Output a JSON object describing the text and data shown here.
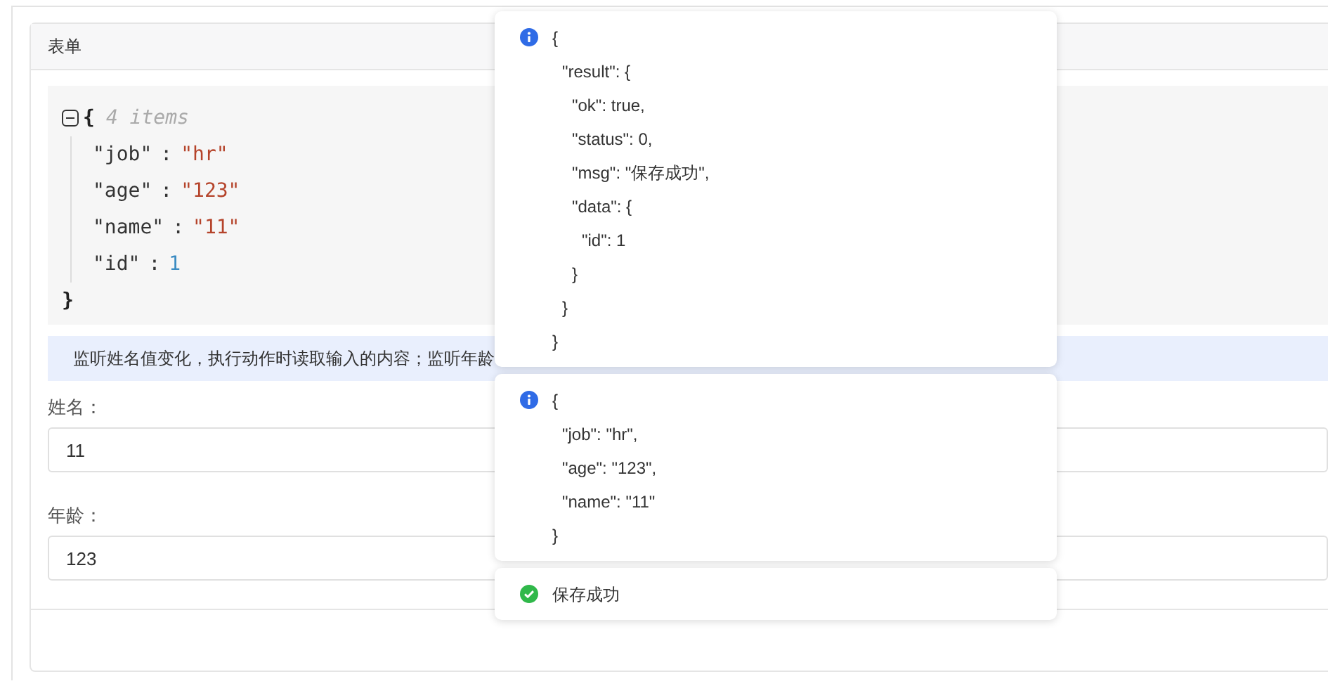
{
  "panel": {
    "title": "表单"
  },
  "json_view": {
    "expanded": true,
    "open_brace": "{",
    "summary": "4 items",
    "close_brace": "}",
    "entries": [
      {
        "key": "\"job\"",
        "separator": ":",
        "value": "\"hr\"",
        "kind": "string"
      },
      {
        "key": "\"age\"",
        "separator": ":",
        "value": "\"123\"",
        "kind": "string"
      },
      {
        "key": "\"name\"",
        "separator": ":",
        "value": "\"11\"",
        "kind": "string"
      },
      {
        "key": "\"id\"",
        "separator": ":",
        "value": "1",
        "kind": "number"
      }
    ]
  },
  "alert": {
    "text": "监听姓名值变化，执行动作时读取输入的内容；监听年龄"
  },
  "fields": [
    {
      "label": "姓名：",
      "value": "11"
    },
    {
      "label": "年龄：",
      "value": "123"
    }
  ],
  "toasts": [
    {
      "kind": "info",
      "tree": {
        "text": "{",
        "children": [
          {
            "text": "\"result\": {",
            "children": [
              {
                "text": "\"ok\": true,"
              },
              {
                "text": "\"status\": 0,"
              },
              {
                "text": "\"msg\": \"保存成功\","
              },
              {
                "text": "\"data\": {",
                "children": [
                  {
                    "text": "\"id\": 1"
                  }
                ],
                "close": "}"
              }
            ],
            "close": "}"
          }
        ],
        "close": "}"
      }
    },
    {
      "kind": "info",
      "tree": {
        "text": "{",
        "children": [
          {
            "text": "\"job\": \"hr\","
          },
          {
            "text": "\"age\": \"123\","
          },
          {
            "text": "\"name\": \"11\""
          }
        ],
        "close": "}"
      }
    },
    {
      "kind": "success",
      "text": "保存成功"
    }
  ]
}
